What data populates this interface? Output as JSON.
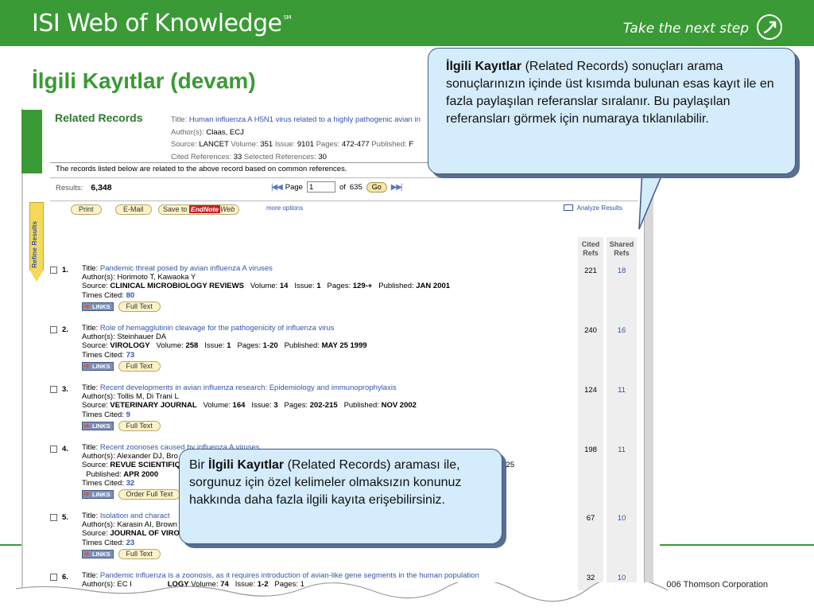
{
  "header": {
    "brand": "ISI Web of Knowledge",
    "brand_mark": "SM",
    "tagline": "Take the next step"
  },
  "slide_title": "İlgili Kayıtlar (devam)",
  "related": {
    "heading": "Related Records",
    "meta": {
      "title_label": "Title:",
      "title_value": "Human influenza A H5N1 virus related to a highly pathogenic avian in",
      "authors_label": "Author(s):",
      "authors_value": "Claas, ECJ",
      "source_label": "Source:",
      "source_journal": "LANCET",
      "source_volume_label": "Volume:",
      "source_volume": "351",
      "source_issue_label": "Issue:",
      "source_issue": "9101",
      "source_pages_label": "Pages:",
      "source_pages": "472-477",
      "source_published_label": "Published:",
      "source_published": "F",
      "cited_label": "Cited References:",
      "cited_value": "33",
      "selected_label": "Selected References:",
      "selected_value": "30"
    },
    "common_note": "The records listed below are related to the above record based on common references.",
    "results_label": "Results:",
    "results_count": "6,348",
    "page_label": "Page",
    "page_value": "1",
    "of_label": "of",
    "total_pages": "635",
    "go_label": "Go",
    "print_label": "Print",
    "email_label": "E-Mail",
    "save_prefix": "Save to",
    "endnote_label": "EndNote",
    "web_label": "Web",
    "more_options": "more options",
    "analyze_label": "Analyze Results",
    "refine_label": "Refine Results",
    "col_cited_l1": "Cited",
    "col_cited_l2": "Refs",
    "col_shared_l1": "Shared",
    "col_shared_l2": "Refs",
    "links_label": "LINKS",
    "labels": {
      "title": "Title:",
      "authors": "Author(s):",
      "source": "Source:",
      "volume": "Volume:",
      "issue": "Issue:",
      "pages": "Pages:",
      "published": "Published:",
      "times_cited": "Times Cited:"
    },
    "records": [
      {
        "num": "1.",
        "title": "Pandemic threat posed by avian influenza A viruses",
        "authors": "Horimoto T, Kawaoka Y",
        "journal": "CLINICAL MICROBIOLOGY REVIEWS",
        "volume": "14",
        "issue": "1",
        "pages": "129-+",
        "published": "JAN 2001",
        "times_cited": "80",
        "fulltext": "Full Text",
        "cited": "221",
        "shared": "18"
      },
      {
        "num": "2.",
        "title": "Role of hemagglutinin cleavage for the pathogenicity of influenza virus",
        "authors": "Steinhauer DA",
        "journal": "VIROLOGY",
        "volume": "258",
        "issue": "1",
        "pages": "1-20",
        "published": "MAY 25 1999",
        "times_cited": "73",
        "fulltext": "Full Text",
        "cited": "240",
        "shared": "16"
      },
      {
        "num": "3.",
        "title": "Recent developments in avian influenza research: Epidemiology and immunoprophylaxis",
        "authors": "Tollis M, Di Trani L",
        "journal": "VETERINARY JOURNAL",
        "volume": "164",
        "issue": "3",
        "pages": "202-215",
        "published": "NOV 2002",
        "times_cited": "9",
        "fulltext": "Full Text",
        "cited": "124",
        "shared": "11"
      },
      {
        "num": "4.",
        "title": "Recent zoonoses caused by influenza A viruses",
        "authors": "Alexander DJ, Bro",
        "journal": "REVUE SCIENTIFIQU",
        "pages_tail": "es: 197-225",
        "published": "APR 2000",
        "times_cited": "32",
        "fulltext": "Order Full Text",
        "cited": "198",
        "shared": "11"
      },
      {
        "num": "5.",
        "title": "Isolation and charact",
        "authors": "Karasin AI, Brown",
        "journal": "JOURNAL OF VIROL",
        "times_cited": "23",
        "fulltext": "Full Text",
        "cited": "67",
        "shared": "10"
      },
      {
        "num": "6.",
        "title": "Pandemic influenza is a zoonosis, as it requires introduction of avian-like gene segments in the human population",
        "authors_partial": "EC I",
        "journal_tail": "LOGY",
        "volume": "74",
        "issue": "1-2",
        "pages_partial": "Pages: 1",
        "cited": "32",
        "shared": "10"
      }
    ]
  },
  "callout1": {
    "bold": "İlgili Kayıtlar",
    "text": " (Related Records) sonuçları arama sonuçlarınızın içinde üst kısımda bulunan esas kayıt ile en fazla paylaşılan referanslar sıralanır. Bu paylaşılan referansları görmek için numaraya tıklanılabilir."
  },
  "callout2": {
    "prefix": "Bir ",
    "bold": "İlgili Kayıtlar",
    "text": " (Related Records) araması ile, sorgunuz için özel kelimeler olmaksızın konunuz hakkında daha fazla ilgili kayıta erişebilirsiniz."
  },
  "copyright": "006 Thomson Corporation",
  "colors": {
    "brand_green": "#3a9a35",
    "callout_fill": "#d4ecfb",
    "link_blue": "#3355aa"
  }
}
